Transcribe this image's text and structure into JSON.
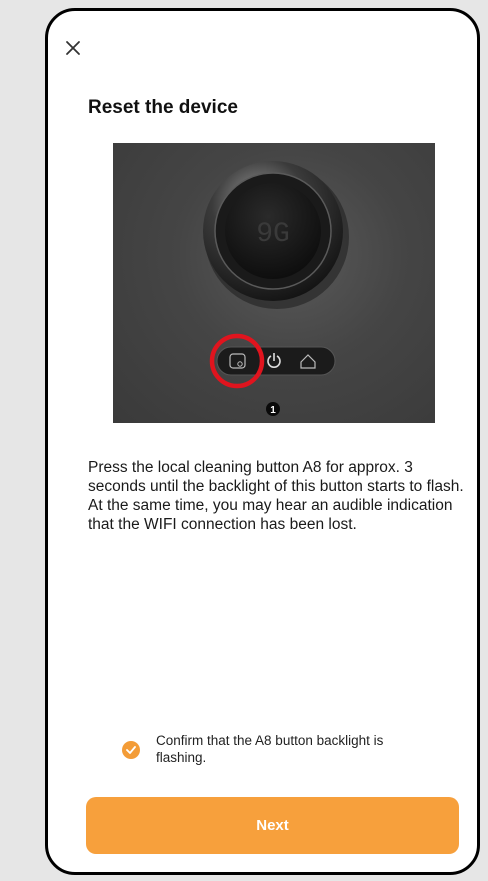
{
  "header": {
    "close_icon": "close-icon",
    "title": "Reset the device"
  },
  "image": {
    "display_digits": "9G",
    "step_marker": "1",
    "highlight_color": "#e0141e"
  },
  "instructions": {
    "text": "Press the local cleaning button A8 for approx. 3 seconds until the backlight of this button starts to flash. At the same time, you may hear an audible indication that the WIFI connection has been lost."
  },
  "confirmation": {
    "checked": true,
    "label": "Confirm that the A8 button backlight is flashing."
  },
  "footer": {
    "next_label": "Next"
  },
  "colors": {
    "accent": "#f7a03c",
    "check": "#f39c37"
  }
}
